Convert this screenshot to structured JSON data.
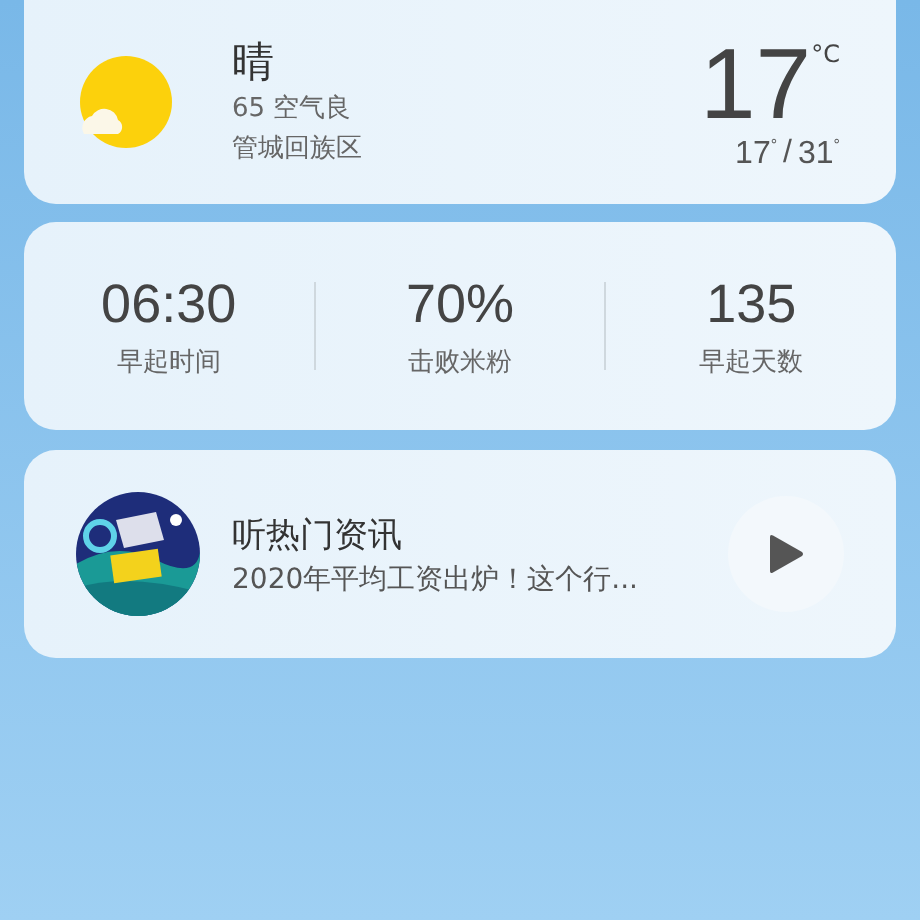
{
  "weather": {
    "condition": "晴",
    "air_quality": "65 空气良",
    "location": "管城回族区",
    "temperature": "17",
    "unit": "°C",
    "low": "17$^{°}$",
    "separator": "/",
    "high": "31$^{°}$"
  },
  "stats": [
    {
      "value": "06:30",
      "label": "早起时间"
    },
    {
      "value": "70%",
      "label": "击败米粉"
    },
    {
      "value": "135",
      "label": "早起天数"
    }
  ],
  "news": {
    "title": "听热门资讯",
    "subtitle": "2020年平均工资出炉！这个行...",
    "playing": false
  }
}
